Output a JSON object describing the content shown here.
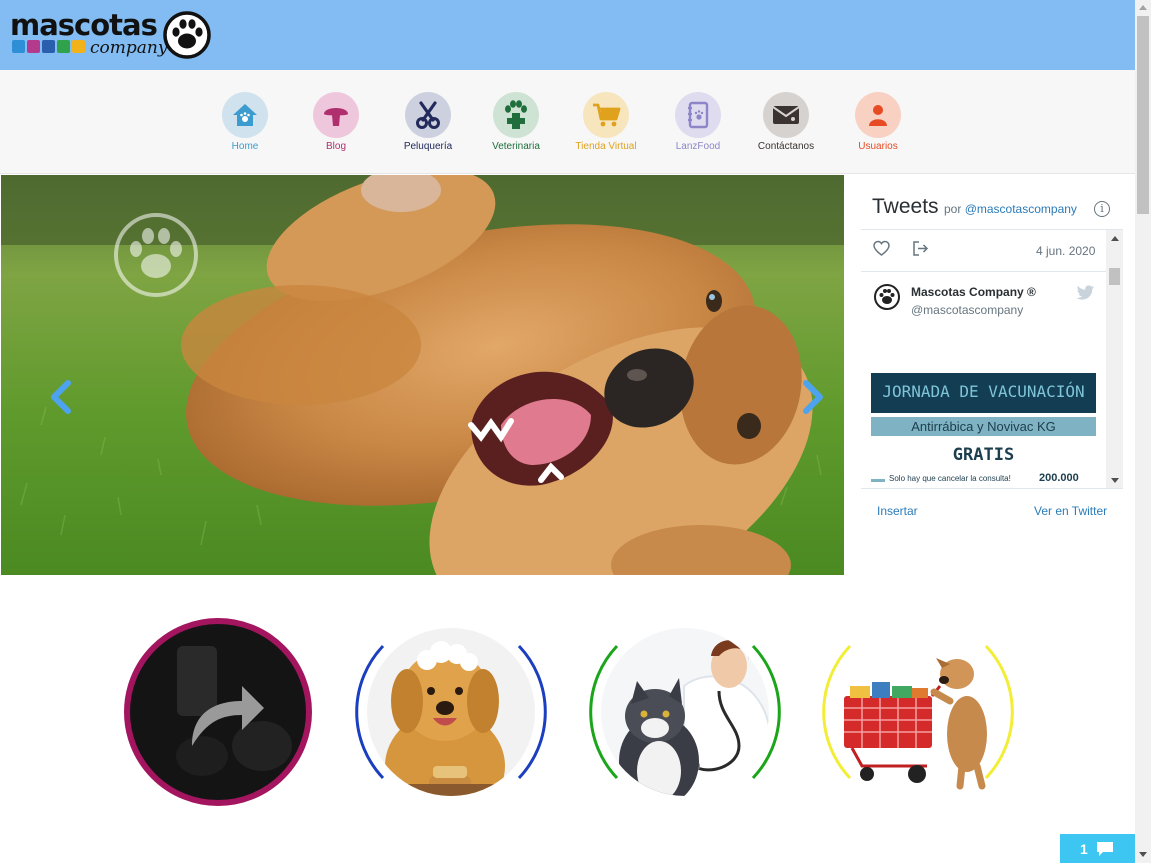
{
  "brand": {
    "name": "mascotas",
    "sub": "company"
  },
  "nav": {
    "items": [
      {
        "label": "Home",
        "color": "#3c9ccf",
        "bg": "#cfe2ee",
        "icon": "house-paw-icon"
      },
      {
        "label": "Blog",
        "color": "#b0306f",
        "bg": "#efc7dc",
        "icon": "mushroom-icon"
      },
      {
        "label": "Peluquería",
        "color": "#222a5c",
        "bg": "#cdd0df",
        "icon": "scissors-icon"
      },
      {
        "label": "Veterinaria",
        "color": "#1f6e3c",
        "bg": "#cfe3d5",
        "icon": "paw-cross-icon"
      },
      {
        "label": "Tienda Virtual",
        "color": "#e0a11c",
        "bg": "#f7e5bd",
        "icon": "cart-icon"
      },
      {
        "label": "LanzFood",
        "color": "#8c86c8",
        "bg": "#dfdcef",
        "icon": "notebook-icon"
      },
      {
        "label": "Contáctanos",
        "color": "#3a3330",
        "bg": "#d6d2cf",
        "icon": "envelope-icon"
      },
      {
        "label": "Usuarios",
        "color": "#e64b24",
        "bg": "#f8d1c3",
        "icon": "user-icon"
      }
    ]
  },
  "twitter": {
    "title": "Tweets",
    "by_prefix": "por",
    "by_handle": "@mascotascompany",
    "info": "i",
    "date": "4 jun. 2020",
    "name": "Mascotas Company ®",
    "handle": "@mascotascompany",
    "media_title": "JORNADA DE VACUNACIÓN",
    "media_sub": "Antirrábica y Novivac KG",
    "media_free": "GRATIS",
    "media_note": "Solo hay que cancelar la consulta!",
    "media_price": "200.000",
    "embed": "Insertar",
    "view": "Ver en Twitter"
  },
  "services": [
    {
      "name": "share",
      "ring": "#a3155e"
    },
    {
      "name": "grooming",
      "ring": "#1b3fbf"
    },
    {
      "name": "vet",
      "ring": "#1aa51a"
    },
    {
      "name": "shop",
      "ring": "#f2ee37"
    }
  ],
  "chat": {
    "count": "1"
  }
}
